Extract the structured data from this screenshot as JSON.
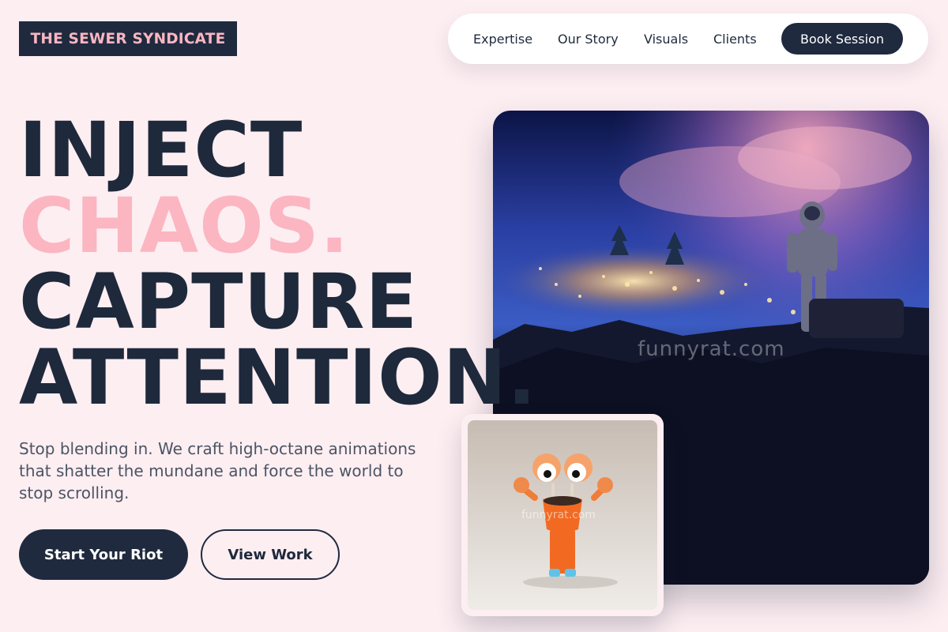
{
  "brand": {
    "name": "THE SEWER SYNDICATE"
  },
  "nav": {
    "links": [
      "Expertise",
      "Our Story",
      "Visuals",
      "Clients"
    ],
    "cta": "Book Session"
  },
  "hero": {
    "headline": [
      "INJECT",
      "CHAOS.",
      "CAPTURE",
      "ATTENTION."
    ],
    "subtext": "Stop blending in. We craft high-octane animations that shatter the mundane and force the world to stop scrolling.",
    "primary_button": "Start Your Riot",
    "secondary_button": "View Work"
  },
  "media": {
    "main_image_watermark": "funnyrat.com",
    "card_watermark": "funnyrat.com"
  },
  "colors": {
    "background": "#fdeef2",
    "navy": "#1f2a3f",
    "pink_accent": "#fbb6c1"
  }
}
